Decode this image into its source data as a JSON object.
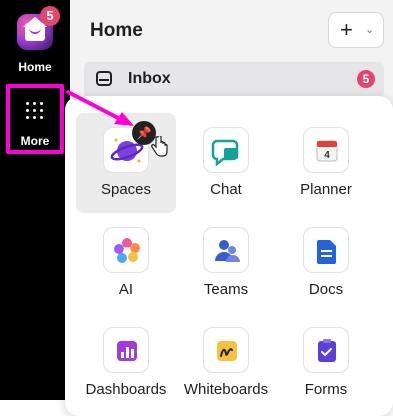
{
  "sidebar": {
    "home": {
      "label": "Home",
      "badge": "5"
    },
    "more": {
      "label": "More"
    }
  },
  "header": {
    "title": "Home",
    "add_button": {
      "symbol": "+",
      "chevron": "⌄"
    }
  },
  "inbox": {
    "label": "Inbox",
    "badge": "5"
  },
  "apps": [
    {
      "label": "Spaces",
      "icon": "planet-icon"
    },
    {
      "label": "Chat",
      "icon": "chat-icon"
    },
    {
      "label": "Planner",
      "icon": "calendar-icon",
      "icon_text": "4"
    },
    {
      "label": "AI",
      "icon": "ai-flower-icon"
    },
    {
      "label": "Teams",
      "icon": "teams-icon"
    },
    {
      "label": "Docs",
      "icon": "document-icon"
    },
    {
      "label": "Dashboards",
      "icon": "dashboard-icon"
    },
    {
      "label": "Whiteboards",
      "icon": "whiteboard-icon"
    },
    {
      "label": "Forms",
      "icon": "form-icon"
    }
  ],
  "colors": {
    "badge": "#e2466e",
    "highlight": "#ff00d4"
  }
}
